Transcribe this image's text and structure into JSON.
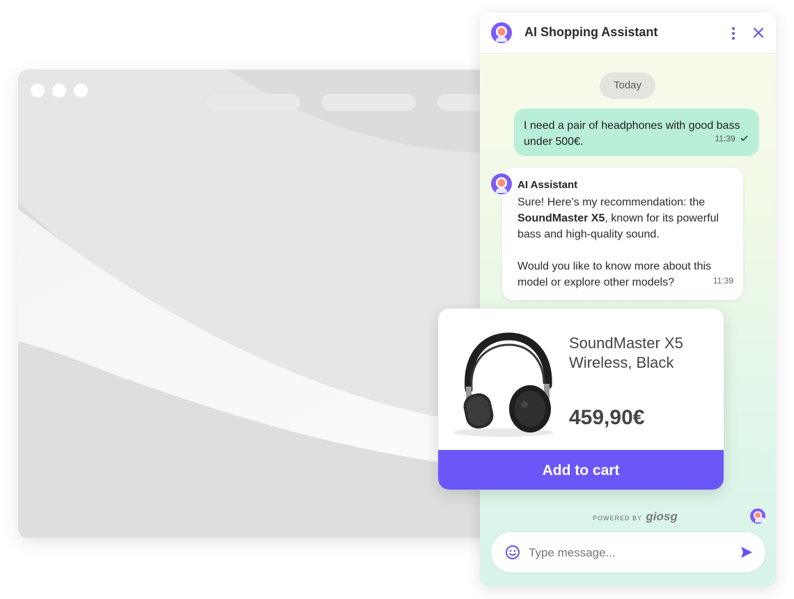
{
  "chat": {
    "title": "AI Shopping Assistant",
    "date_chip": "Today",
    "user_message": {
      "text": "I need a pair of headphones with good bass under 500€.",
      "time": "11:39",
      "status_icon": "check-icon"
    },
    "bot_message": {
      "sender": "AI Assistant",
      "line1_prefix": "Sure! Here’s my recommendation: the ",
      "product_bold": "SoundMaster X5",
      "line1_suffix": ", known for its powerful bass and high-quality sound.",
      "line2": "Would you like to know more about this model or explore other models?",
      "time": "11:39"
    },
    "powered_by": {
      "prefix": "POWERED BY",
      "brand": "giosg"
    },
    "input": {
      "placeholder": "Type message..."
    }
  },
  "product": {
    "name": "SoundMaster X5 Wireless, Black",
    "price": "459,90€",
    "cta_label": "Add to cart",
    "image_icon": "headphones-icon"
  },
  "colors": {
    "accent": "#6b57f7",
    "user_bubble": "#b9eed8",
    "header_icons": "#6b4ff0"
  }
}
